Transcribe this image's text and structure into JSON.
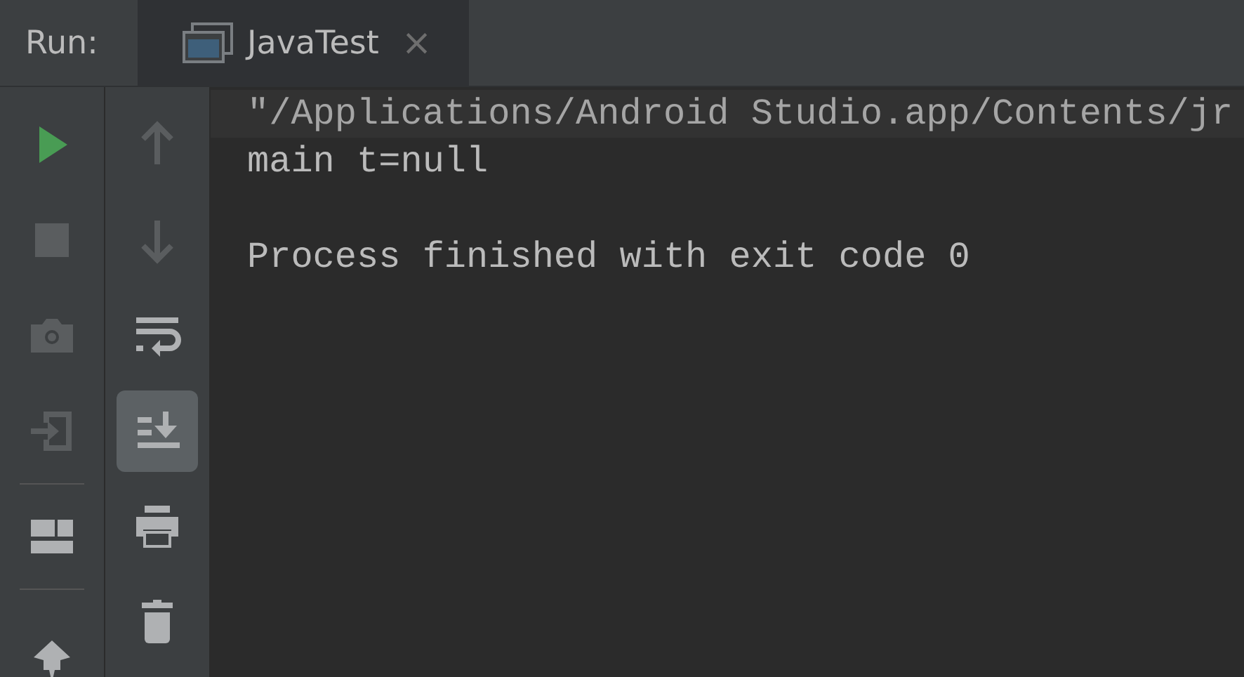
{
  "header": {
    "title": "Run:"
  },
  "tabs": [
    {
      "label": "JavaTest",
      "selected": true,
      "close_label": "×"
    }
  ],
  "left_toolbar": [
    {
      "kind": "run",
      "disabled": false
    },
    {
      "kind": "stop",
      "disabled": true
    },
    {
      "kind": "camera",
      "disabled": true
    },
    {
      "kind": "login",
      "disabled": true
    },
    {
      "kind": "separator"
    },
    {
      "kind": "layout",
      "disabled": false
    },
    {
      "kind": "separator"
    },
    {
      "kind": "pin"
    }
  ],
  "right_toolbar": [
    {
      "kind": "up",
      "disabled": true,
      "selected": false
    },
    {
      "kind": "down",
      "disabled": true,
      "selected": false
    },
    {
      "kind": "wrap",
      "disabled": false,
      "selected": false
    },
    {
      "kind": "scroll-end",
      "disabled": false,
      "selected": true
    },
    {
      "kind": "print",
      "disabled": false,
      "selected": false
    },
    {
      "kind": "trash",
      "disabled": false,
      "selected": false
    }
  ],
  "console": [
    {
      "kind": "command",
      "text": "\"/Applications/Android Studio.app/Contents/jr"
    },
    {
      "kind": "output",
      "text": "main t=null"
    },
    {
      "kind": "exit-status",
      "text": "Process finished with exit code 0"
    }
  ]
}
